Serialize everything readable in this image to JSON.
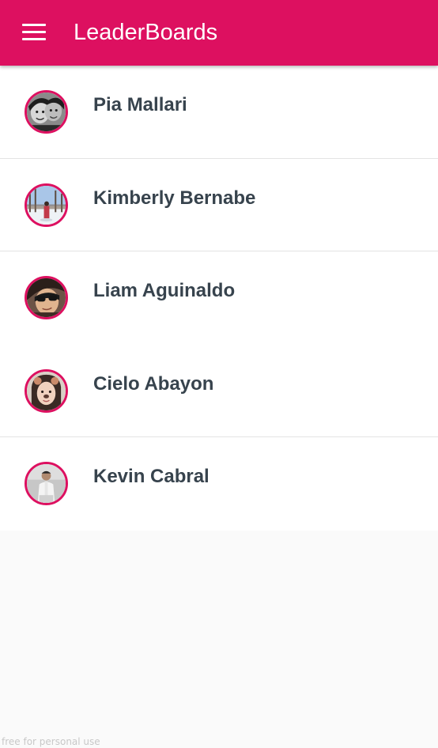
{
  "appbar": {
    "title": "LeaderBoards",
    "menu_icon": "hamburger-menu-icon",
    "color": "#dd1060"
  },
  "leaderboard": {
    "entries": [
      {
        "name": "Pia Mallari",
        "avatar": "avatar-photo-bw"
      },
      {
        "name": "Kimberly Bernabe",
        "avatar": "avatar-photo-snow"
      },
      {
        "name": "Liam Aguinaldo",
        "avatar": "avatar-photo-sunglasses"
      },
      {
        "name": "Cielo Abayon",
        "avatar": "avatar-photo-filter"
      },
      {
        "name": "Kevin Cabral",
        "avatar": "avatar-photo-white-shirt"
      }
    ]
  },
  "watermark": "free for personal use"
}
